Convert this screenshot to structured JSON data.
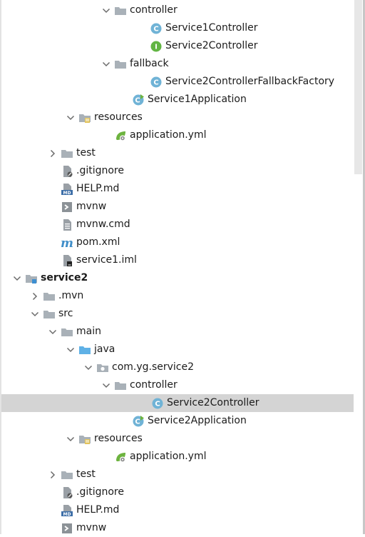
{
  "tree": [
    {
      "depth": 6,
      "label": "controller",
      "icon": "folder-icon",
      "arrow": "expanded"
    },
    {
      "depth": 8,
      "label": "Service1Controller",
      "icon": "java-class-icon",
      "arrow": "none"
    },
    {
      "depth": 8,
      "label": "Service2Controller",
      "icon": "java-interface-icon",
      "arrow": "none"
    },
    {
      "depth": 6,
      "label": "fallback",
      "icon": "folder-icon",
      "arrow": "expanded"
    },
    {
      "depth": 8,
      "label": "Service2ControllerFallbackFactory",
      "icon": "java-class-icon",
      "arrow": "none"
    },
    {
      "depth": 7,
      "label": "Service1Application",
      "icon": "spring-boot-class-icon",
      "arrow": "none"
    },
    {
      "depth": 4,
      "label": "resources",
      "icon": "resources-folder-icon",
      "arrow": "expanded"
    },
    {
      "depth": 6,
      "label": "application.yml",
      "icon": "spring-config-icon",
      "arrow": "none"
    },
    {
      "depth": 3,
      "label": "test",
      "icon": "folder-icon",
      "arrow": "collapsed"
    },
    {
      "depth": 3,
      "label": ".gitignore",
      "icon": "gitignore-file-icon",
      "arrow": "none"
    },
    {
      "depth": 3,
      "label": "HELP.md",
      "icon": "markdown-file-icon",
      "arrow": "none"
    },
    {
      "depth": 3,
      "label": "mvnw",
      "icon": "shell-script-icon",
      "arrow": "none"
    },
    {
      "depth": 3,
      "label": "mvnw.cmd",
      "icon": "text-file-icon",
      "arrow": "none"
    },
    {
      "depth": 3,
      "label": "pom.xml",
      "icon": "maven-icon",
      "arrow": "none"
    },
    {
      "depth": 3,
      "label": "service1.iml",
      "icon": "iml-file-icon",
      "arrow": "none"
    },
    {
      "depth": 1,
      "label": "service2",
      "icon": "module-folder-icon",
      "arrow": "expanded",
      "bold": true
    },
    {
      "depth": 2,
      "label": ".mvn",
      "icon": "folder-icon",
      "arrow": "collapsed"
    },
    {
      "depth": 2,
      "label": "src",
      "icon": "folder-icon",
      "arrow": "expanded"
    },
    {
      "depth": 3,
      "label": "main",
      "icon": "folder-icon",
      "arrow": "expanded"
    },
    {
      "depth": 4,
      "label": "java",
      "icon": "source-folder-icon",
      "arrow": "expanded"
    },
    {
      "depth": 5,
      "label": "com.yg.service2",
      "icon": "package-icon",
      "arrow": "expanded"
    },
    {
      "depth": 6,
      "label": "controller",
      "icon": "folder-icon",
      "arrow": "expanded"
    },
    {
      "depth": 8,
      "label": "Service2Controller",
      "icon": "java-class-icon",
      "arrow": "none",
      "selected": true
    },
    {
      "depth": 7,
      "label": "Service2Application",
      "icon": "spring-boot-class-icon",
      "arrow": "none"
    },
    {
      "depth": 4,
      "label": "resources",
      "icon": "resources-folder-icon",
      "arrow": "expanded"
    },
    {
      "depth": 6,
      "label": "application.yml",
      "icon": "spring-config-icon",
      "arrow": "none"
    },
    {
      "depth": 3,
      "label": "test",
      "icon": "folder-icon",
      "arrow": "collapsed"
    },
    {
      "depth": 3,
      "label": ".gitignore",
      "icon": "gitignore-file-icon",
      "arrow": "none"
    },
    {
      "depth": 3,
      "label": "HELP.md",
      "icon": "markdown-file-icon",
      "arrow": "none"
    },
    {
      "depth": 3,
      "label": "mvnw",
      "icon": "shell-script-icon",
      "arrow": "none"
    }
  ],
  "icon_text": {
    "class_letter": "C",
    "interface_letter": "I",
    "markdown_text": "MD",
    "maven_letter": "m"
  },
  "colors": {
    "folder": "#a9b1b8",
    "source_folder": "#5fb1e6",
    "class": "#70b3d6",
    "interface": "#62b543",
    "spring": "#6db33f",
    "selection": "#d4d4d4",
    "maven": "#3f8ec9"
  }
}
